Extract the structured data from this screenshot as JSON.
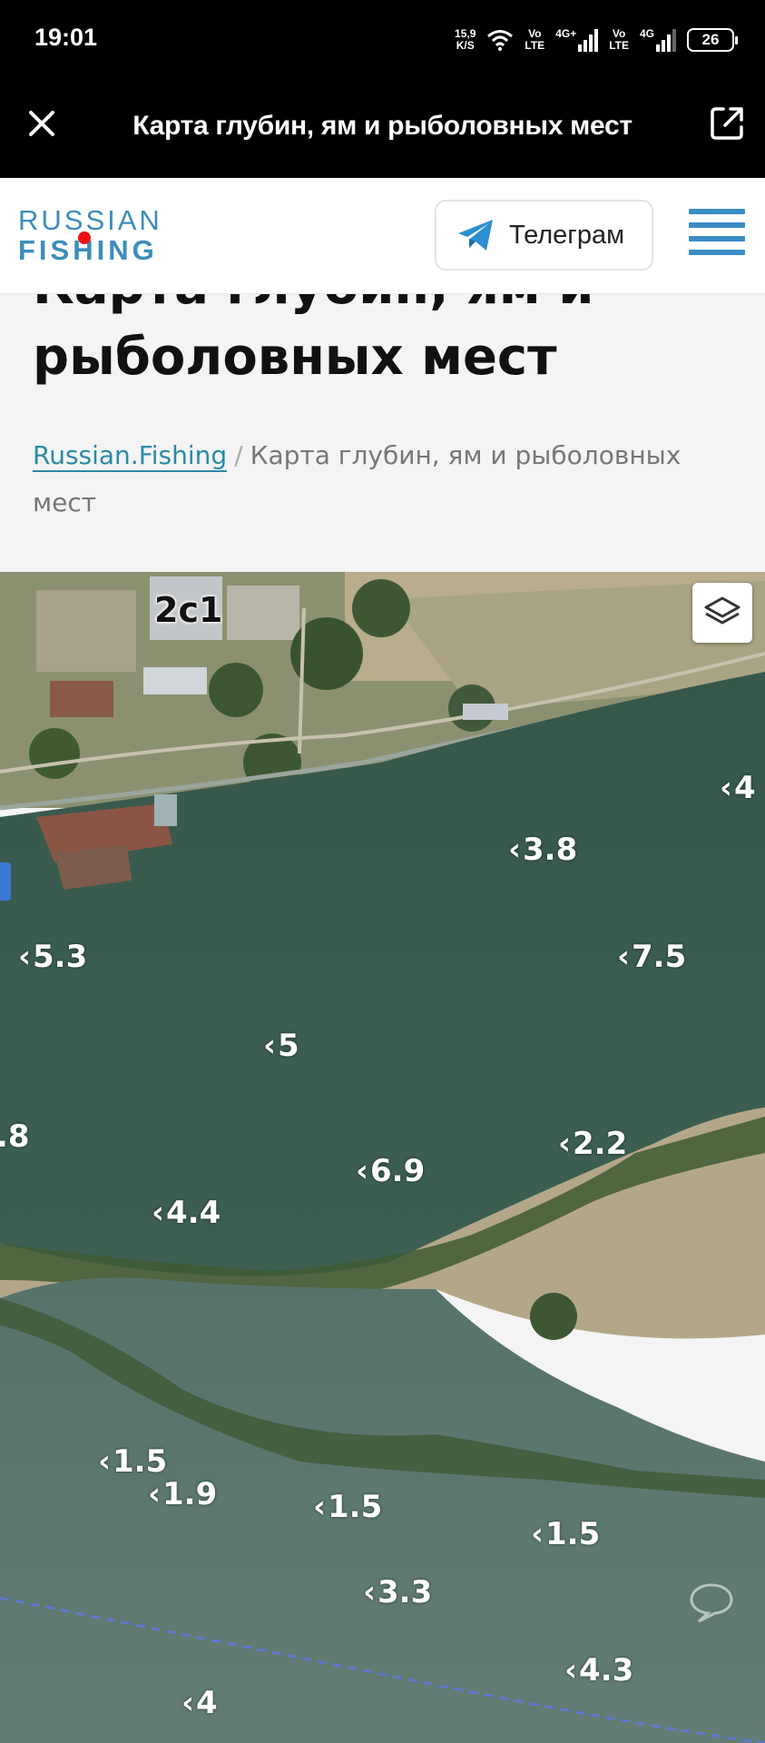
{
  "status_bar": {
    "time": "19:01",
    "speed_value": "15,9",
    "speed_unit": "K/S",
    "network1": "Vo\nLTE",
    "network1_top": "Vo",
    "network1_bottom": "LTE",
    "net_type1": "4G+",
    "network2_top": "Vo",
    "network2_bottom": "LTE",
    "net_type2": "4G",
    "battery": "26"
  },
  "toolbar": {
    "title": "Карта глубин, ям и рыболовных мест",
    "close_icon": "close-icon",
    "external_icon": "open-external-icon"
  },
  "header": {
    "logo_line1": "RUSSIAN",
    "logo_line2": "FISHING",
    "telegram_label": "Телеграм",
    "accent_color": "#3b8cc4"
  },
  "page": {
    "title": "Карта глубин, ям и рыболовных мест",
    "breadcrumb_home": "Russian.Fishing",
    "breadcrumb_sep": "/",
    "breadcrumb_current": "Карта глубин, ям и рыболовных мест"
  },
  "map": {
    "building_label": "2с1",
    "depths": [
      {
        "label": "4"
      },
      {
        "label": "3.8"
      },
      {
        "label": "5.3"
      },
      {
        "label": "7.5"
      },
      {
        "label": "5"
      },
      {
        "label": ".8"
      },
      {
        "label": "2.2"
      },
      {
        "label": "6.9"
      },
      {
        "label": "4.4"
      },
      {
        "label": "1.5"
      },
      {
        "label": "1.9"
      },
      {
        "label": "1.5"
      },
      {
        "label": "1.5"
      },
      {
        "label": "3.3"
      },
      {
        "label": "4.3"
      },
      {
        "label": "4"
      }
    ]
  }
}
